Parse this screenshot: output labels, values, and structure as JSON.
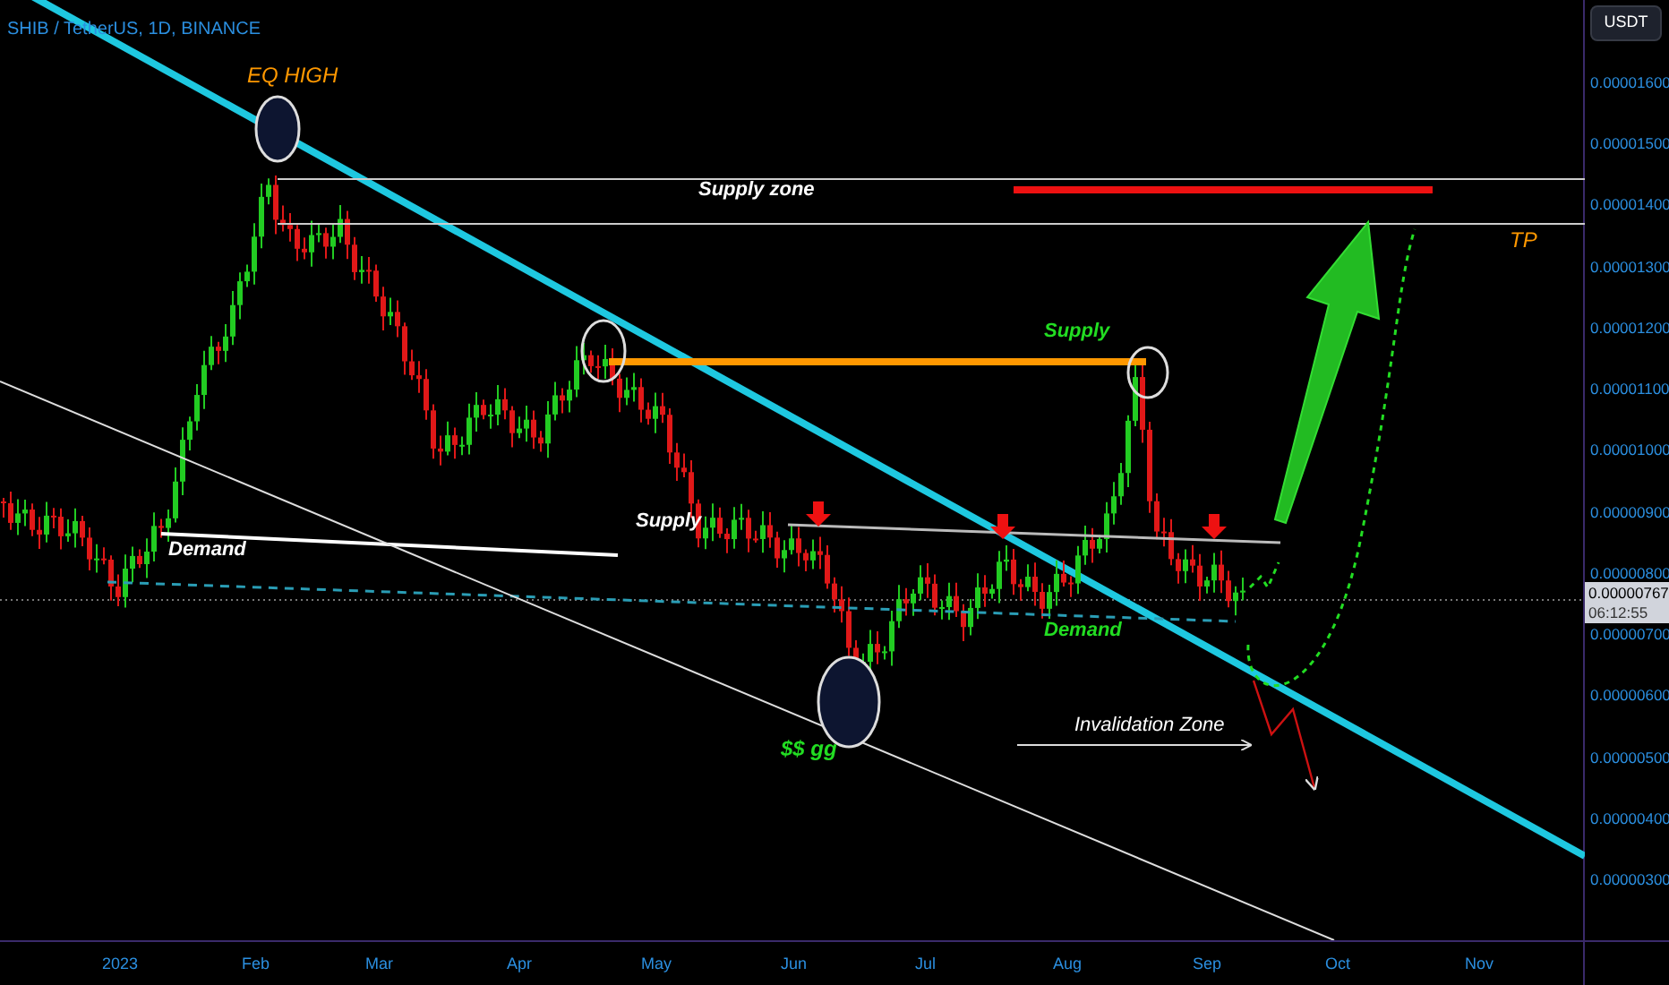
{
  "header": {
    "symbol_title": "SHIB / TetherUS, 1D, BINANCE",
    "currency_button": "USDT"
  },
  "annotations": [
    {
      "text": "EQ HIGH",
      "color": "#ff9800"
    },
    {
      "text": "Supply zone",
      "color": "#ffffff"
    },
    {
      "text": "TP",
      "color": "#ff9800"
    },
    {
      "text": "Supply",
      "color": "#22dd22"
    },
    {
      "text": "Supply",
      "color": "#ffffff"
    },
    {
      "text": "Demand",
      "color": "#ffffff"
    },
    {
      "text": "Demand",
      "color": "#22dd22"
    },
    {
      "text": "$$ gg",
      "color": "#22dd22"
    },
    {
      "text": "Invalidation Zone",
      "color": "#ffffff"
    }
  ],
  "price_axis": {
    "ticks": [
      "0.00001600",
      "0.00001500",
      "0.00001400",
      "0.00001300",
      "0.00001200",
      "0.00001100",
      "0.00001000",
      "0.00000900",
      "0.00000800",
      "0.00000700",
      "0.00000600",
      "0.00000500",
      "0.00000400",
      "0.00000300"
    ],
    "last_price": "0.00000767",
    "countdown": "06:12:55"
  },
  "time_axis": {
    "labels": [
      "2023",
      "Feb",
      "Mar",
      "Apr",
      "May",
      "Jun",
      "Jul",
      "Aug",
      "Sep",
      "Oct",
      "Nov"
    ]
  }
}
